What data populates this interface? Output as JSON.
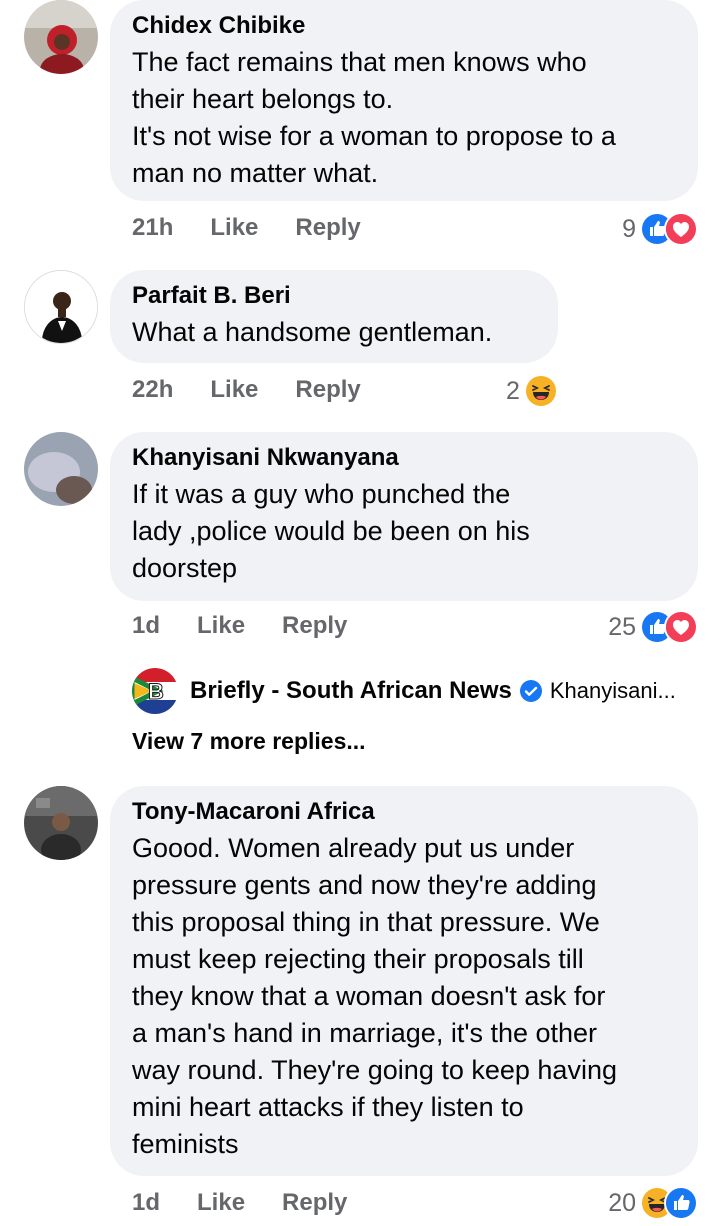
{
  "comments": [
    {
      "author": "Chidex Chibike",
      "text": "The fact remains that men knows who\ntheir heart belongs to.\nIt's not wise for a woman to propose to a\nman no matter what.",
      "time": "21h",
      "like_label": "Like",
      "reply_label": "Reply",
      "reaction_count": "9",
      "reactions": [
        "like-icon",
        "love-icon"
      ]
    },
    {
      "author": "Parfait B. Beri",
      "text": "What a handsome gentleman.",
      "time": "22h",
      "like_label": "Like",
      "reply_label": "Reply",
      "reaction_count": "2",
      "reactions": [
        "haha-icon"
      ]
    },
    {
      "author": "Khanyisani Nkwanyana",
      "text": "If it was a guy who punched the\nlady ,police would be been on his\ndoorstep",
      "time": "1d",
      "like_label": "Like",
      "reply_label": "Reply",
      "reaction_count": "25",
      "reactions": [
        "like-icon",
        "love-icon"
      ],
      "reply_preview": {
        "page_name": "Briefly - South African News",
        "badge": "verified-icon",
        "preview_text": "Khanyisani..."
      },
      "view_more": "View 7 more replies..."
    },
    {
      "author": "Tony-Macaroni Africa",
      "text": "Goood. Women already put us under\npressure gents and now they're adding\nthis proposal thing in that pressure. We\nmust keep rejecting their proposals till\nthey know that a woman doesn't ask for\na man's hand in marriage, it's the other\nway round. They're going to keep having\nmini heart attacks if they listen to\nfeminists",
      "time": "1d",
      "like_label": "Like",
      "reply_label": "Reply",
      "reaction_count": "20",
      "reactions": [
        "haha-icon",
        "like-icon"
      ]
    }
  ],
  "colors": {
    "like": "#1877f2",
    "love": "#f33e58",
    "haha": "#f7b125",
    "bubble": "#f0f2f5",
    "meta": "#65676b"
  }
}
